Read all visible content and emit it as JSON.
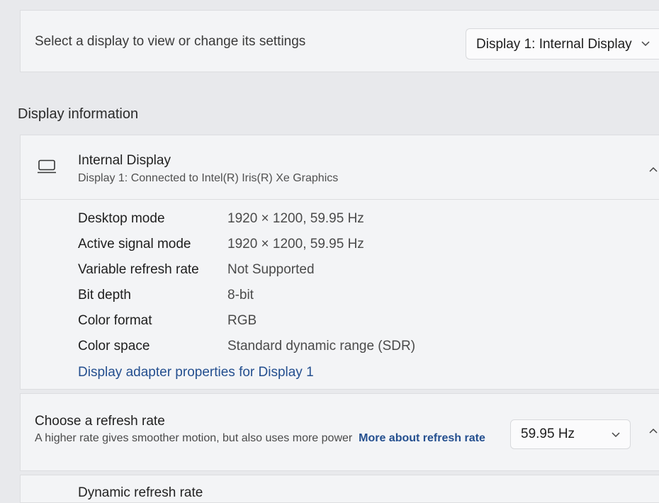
{
  "display_select": {
    "label": "Select a display to view or change its settings",
    "selected": "Display 1: Internal Display"
  },
  "section": {
    "heading": "Display information"
  },
  "display": {
    "name": "Internal Display",
    "connection": "Display 1: Connected to Intel(R) Iris(R) Xe Graphics",
    "rows": [
      {
        "label": "Desktop mode",
        "value": "1920 × 1200, 59.95 Hz"
      },
      {
        "label": "Active signal mode",
        "value": "1920 × 1200, 59.95 Hz"
      },
      {
        "label": "Variable refresh rate",
        "value": "Not Supported"
      },
      {
        "label": "Bit depth",
        "value": "8-bit"
      },
      {
        "label": "Color format",
        "value": "RGB"
      },
      {
        "label": "Color space",
        "value": "Standard dynamic range (SDR)"
      }
    ],
    "adapter_link": "Display adapter properties for Display 1"
  },
  "refresh": {
    "title": "Choose a refresh rate",
    "description": "A higher rate gives smoother motion, but also uses more power",
    "link": "More about refresh rate",
    "selected": "59.95 Hz"
  },
  "next_row": {
    "title": "Dynamic refresh rate"
  },
  "icons": [
    "monitor-icon",
    "chevron-down-icon",
    "chevron-up-icon"
  ],
  "colors": {
    "link": "#244f8f",
    "card": "#f3f4f6",
    "background": "#e8e9ec"
  }
}
